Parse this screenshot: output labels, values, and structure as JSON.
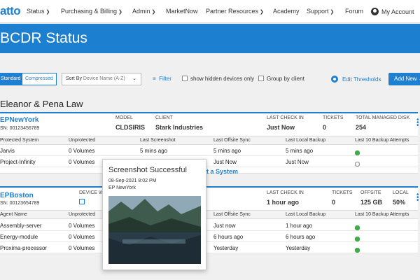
{
  "nav": {
    "logo": "atto",
    "items": [
      "Status",
      "Purchasing & Billing",
      "Admin",
      "MarketNow",
      "Partner Resources",
      "Academy",
      "Support",
      "Forum",
      "My Account"
    ]
  },
  "page": {
    "title": "BCDR Status"
  },
  "toolbar": {
    "view_standard": "Standard",
    "view_compressed": "Compressed",
    "sort_label": "Sort By",
    "sort_value": "Device Name (A-Z)",
    "filter": "Filter",
    "show_hidden": "show hidden devices only",
    "group_by_client": "Group by client",
    "edit_thresholds": "Edit Thresholds",
    "add_new": "Add New"
  },
  "client_name": "Eleanor & Pena Law",
  "device1": {
    "name": "EPNewYork",
    "sn": "SN: 00123456789",
    "model_label": "MODEL",
    "model": "CLDSIRIS",
    "client_label": "CLIENT",
    "client": "Stark Industries",
    "checkin_label": "LAST CHECK IN",
    "checkin": "Just Now",
    "tickets_label": "TICKETS",
    "tickets": "0",
    "disk_label": "TOTAL MANAGED DISK",
    "disk": "254",
    "columns": [
      "Protected System",
      "Unprotected",
      "Last Screenshot",
      "Last Offsite Sync",
      "Last Local Backup",
      "Last 10 Backup Attempts"
    ],
    "rows": [
      {
        "system": "Jarvis",
        "unprotected": "0 Volumes",
        "screenshot": "5 mins ago",
        "offsite": "5 mins ago",
        "local": "5 mins ago"
      },
      {
        "system": "Project-Infinity",
        "unprotected": "0 Volumes",
        "screenshot": "",
        "offsite": "Just Now",
        "local": "Just Now"
      }
    ],
    "protect_link": "ct a System"
  },
  "device2": {
    "name": "EPBoston",
    "sn": "SN: 00123654789",
    "device_label": "DEVICE W",
    "checkin_label": "LAST CHECK IN",
    "checkin": "1 hour ago",
    "tickets_label": "TICKETS",
    "tickets": "0",
    "offsite_label": "OFFSITE",
    "offsite": "125 GB",
    "local_label": "LOCAL",
    "local": "50%",
    "columns": [
      "Agent Name",
      "Unprotected",
      "Last Offsite Sync",
      "Last Local Backup",
      "Last 10 Backup Attempts"
    ],
    "rows": [
      {
        "system": "Assembly-server",
        "unprotected": "0 Volumes",
        "offsite": "Just now",
        "local": "1 hour ago"
      },
      {
        "system": "Energy-module",
        "unprotected": "0 Volumes",
        "offsite": "6 hours ago",
        "local": "6 hours ago"
      },
      {
        "system": "Proxima-processor",
        "unprotected": "0 Volumes",
        "offsite": "Yesterday",
        "local": "Yesterday"
      }
    ]
  },
  "popup": {
    "title": "Screenshot Successful",
    "date": "08-Sep-2021 8:02 PM",
    "system": "EP NewYork"
  },
  "colors": {
    "brand": "#1f7fd1",
    "success": "#3cb043",
    "failure": "#e03030"
  }
}
